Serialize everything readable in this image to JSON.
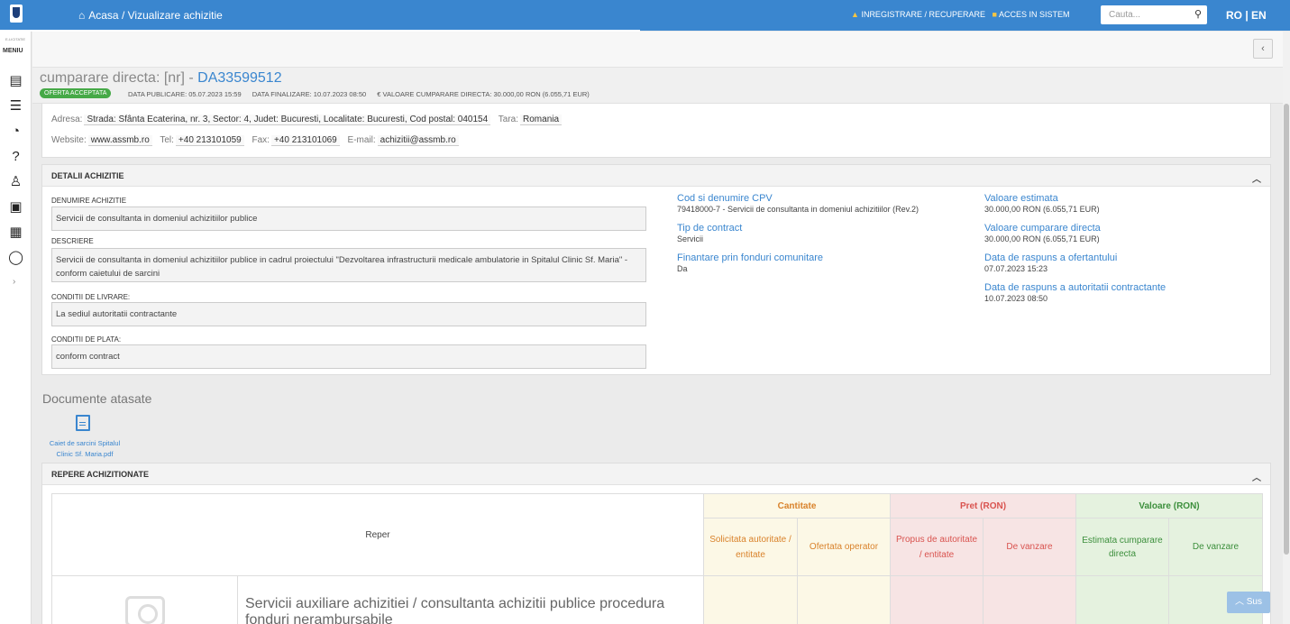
{
  "topbar": {
    "home": "Acasa",
    "separator": "/",
    "page": "Vizualizare achizitie",
    "register": "INREGISTRARE / RECUPERARE",
    "login": "ACCES IN SISTEM",
    "search_placeholder": "Cauta...",
    "lang": "RO | EN"
  },
  "sidebar": {
    "small": "E-LICITATIE",
    "menu": "MENIU"
  },
  "title": {
    "prefix": "cumparare directa: [nr] - ",
    "code": "DA33599512",
    "badge": "OFERTA ACCEPTATA",
    "published": "DATA PUBLICARE: 05.07.2023 15:59",
    "finalized": "DATA FINALIZARE: 10.07.2023 08:50",
    "value": "€ VALOARE CUMPARARE DIRECTA: 30.000,00 RON (6.055,71 EUR)"
  },
  "authority": {
    "address_label": "Adresa:",
    "address": "Strada: Sfânta Ecaterina, nr. 3, Sector: 4, Judet: Bucuresti, Localitate: Bucuresti, Cod postal: 040154",
    "country_label": "Tara:",
    "country": "Romania",
    "website_label": "Website:",
    "website": "www.assmb.ro",
    "tel_label": "Tel:",
    "tel": "+40 213101059",
    "fax_label": "Fax:",
    "fax": "+40 213101069",
    "email_label": "E-mail:",
    "email": "achizitii@assmb.ro"
  },
  "details": {
    "header": "DETALII ACHIZITIE",
    "name_label": "DENUMIRE ACHIZITIE",
    "name": "Servicii de consultanta in domeniul achizitiilor publice",
    "desc_label": "DESCRIERE",
    "desc": "Servicii de consultanta in domeniul achizitiilor publice in cadrul proiectului \"Dezvoltarea infrastructurii medicale ambulatorie in Spitalul Clinic Sf. Maria\" - conform caietului de sarcini",
    "delivery_label": "CONDITII DE LIVRARE:",
    "delivery": "La sediul autoritatii contractante",
    "payment_label": "CONDITII DE PLATA:",
    "payment": "conform contract",
    "cpv_label": "Cod si denumire CPV",
    "cpv": "79418000-7 - Servicii de consultanta in domeniul achizitiilor (Rev.2)",
    "type_label": "Tip de contract",
    "type": "Servicii",
    "eu_label": "Finantare prin fonduri comunitare",
    "eu": "Da",
    "est_label": "Valoare estimata",
    "est": "30.000,00  RON (6.055,71  EUR)",
    "direct_label": "Valoare cumparare directa",
    "direct": "30.000,00  RON (6.055,71  EUR)",
    "resp_bid_label": "Data de raspuns a ofertantului",
    "resp_bid": "07.07.2023 15:23",
    "resp_auth_label": "Data de raspuns a autoritatii contractante",
    "resp_auth": "10.07.2023 08:50"
  },
  "docs": {
    "title": "Documente atasate",
    "file": "Caiet de sarcini Spitalul Clinic Sf. Maria.pdf"
  },
  "repere": {
    "header": "REPERE ACHIZITIONATE",
    "reper": "Reper",
    "qty": "Cantitate",
    "price": "Pret (RON)",
    "value": "Valoare (RON)",
    "c1": "Solicitata autoritate / entitate",
    "c2": "Ofertata operator",
    "c3": "Propus de autoritate / entitate",
    "c4": "De vanzare",
    "c5": "Estimata cumparare directa",
    "c6": "De vanzare",
    "item": "Servicii auxiliare achizitiei / consultanta achizitii publice procedura fonduri nerambursabile"
  },
  "sus": "Sus"
}
